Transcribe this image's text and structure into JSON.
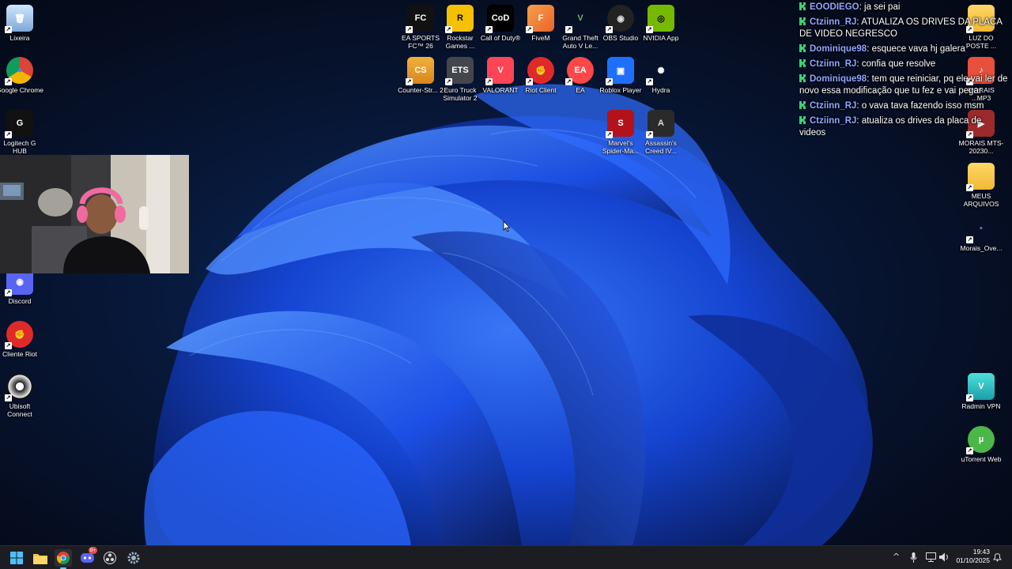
{
  "desktop_left": [
    {
      "name": "recycle-bin",
      "label": "Lixeira",
      "icon": "trash-icon"
    },
    {
      "name": "google-chrome",
      "label": "Google Chrome",
      "icon": "chrome-icon"
    },
    {
      "name": "logitech-g-hub",
      "label": "Logitech G HUB",
      "icon": "logitech-icon"
    },
    {
      "name": "discord",
      "label": "Discord",
      "icon": "discord-icon"
    },
    {
      "name": "cliente-riot",
      "label": "Cliente Riot",
      "icon": "riot-icon"
    },
    {
      "name": "ubisoft-connect",
      "label": "Ubisoft Connect",
      "icon": "ubisoft-icon"
    }
  ],
  "desktop_top": [
    {
      "name": "ea-sports-fc",
      "label": "EA SPORTS FC™ 26",
      "icon": "easports-icon",
      "glyph": "FC"
    },
    {
      "name": "rockstar-games",
      "label": "Rockstar Games ...",
      "icon": "rockstar-icon",
      "glyph": "R"
    },
    {
      "name": "call-of-duty",
      "label": "Call of Duty®",
      "icon": "cod-icon",
      "glyph": "CoD"
    },
    {
      "name": "fivem",
      "label": "FiveM",
      "icon": "fivem-icon",
      "glyph": "F"
    },
    {
      "name": "gta-v",
      "label": "Grand Theft Auto V Le...",
      "icon": "gta-icon",
      "glyph": "V"
    },
    {
      "name": "obs-studio",
      "label": "OBS Studio",
      "icon": "obs-icon",
      "glyph": "◉"
    },
    {
      "name": "nvidia-app",
      "label": "NVIDIA App",
      "icon": "nvidia-icon",
      "glyph": "◎"
    },
    {
      "name": "counter-strike-2",
      "label": "Counter-Str... 2",
      "icon": "cs2-icon",
      "glyph": "CS"
    },
    {
      "name": "euro-truck-simulator-2",
      "label": "Euro Truck Simulator 2",
      "icon": "truck-icon",
      "glyph": "ETS"
    },
    {
      "name": "valorant",
      "label": "VALORANT",
      "icon": "valorant-icon",
      "glyph": "V"
    },
    {
      "name": "riot-client",
      "label": "Riot Client",
      "icon": "riot-icon",
      "glyph": "✊"
    },
    {
      "name": "ea",
      "label": "EA",
      "icon": "ea-icon",
      "glyph": "EA"
    },
    {
      "name": "roblox-player",
      "label": "Roblox Player",
      "icon": "roblox-icon",
      "glyph": "▣"
    },
    {
      "name": "hydra",
      "label": "Hydra",
      "icon": "hydra-icon",
      "glyph": "✺"
    },
    {
      "name": "marvels-spider-man",
      "label": "Marvel's Spider-Ma...",
      "icon": "spiderman-icon",
      "glyph": "S"
    },
    {
      "name": "assassins-creed",
      "label": "Assassin's Creed IV...",
      "icon": "assassins-icon",
      "glyph": "A"
    }
  ],
  "desktop_right": [
    {
      "name": "luz-do-poste",
      "label": "LUZ DO POSTE ...",
      "icon": "folder-icon"
    },
    {
      "name": "morais-mp3",
      "label": "MORAIS ...MP3",
      "icon": "audio-file-icon"
    },
    {
      "name": "morais-mts",
      "label": "MORAIS MTS-20230...",
      "icon": "video-file-icon"
    },
    {
      "name": "meus-arquivos",
      "label": "MEUS ARQUIVOS",
      "icon": "folder-icon"
    },
    {
      "name": "morais-ove",
      "label": "Morais_Ove...",
      "icon": "file-icon"
    },
    {
      "name": "radmin-vpn",
      "label": "Radmin VPN",
      "icon": "radmin-icon"
    },
    {
      "name": "utorrent-web",
      "label": "uTorrent Web",
      "icon": "utorrent-icon"
    }
  ],
  "chat": [
    {
      "user": "EOODIEGO",
      "text": "ja sei pai"
    },
    {
      "user": "Ctziinn_RJ",
      "text": "ATUALIZA OS DRIVES DA PLACA DE VIDEO NEGRESCO"
    },
    {
      "user": "Dominique98",
      "text": "esquece vava hj galera"
    },
    {
      "user": "Ctziinn_RJ",
      "text": "confia que resolve"
    },
    {
      "user": "Dominique98",
      "text": "tem que reiniciar, pq ele vai ler de novo essa modificação que tu fez e vai pegar"
    },
    {
      "user": "Ctziinn_RJ",
      "text": "o vava tava fazendo isso msm"
    },
    {
      "user": "Ctziinn_RJ",
      "text": "atualiza os drives da placa de videos"
    }
  ],
  "taskbar": {
    "apps": [
      {
        "name": "start-button",
        "icon": "windows-icon"
      },
      {
        "name": "file-explorer",
        "icon": "folder-icon"
      },
      {
        "name": "chrome",
        "icon": "chrome-icon"
      },
      {
        "name": "discord",
        "icon": "discord-icon",
        "badge": "9+"
      },
      {
        "name": "obs",
        "icon": "obs-icon"
      },
      {
        "name": "settings",
        "icon": "gear-icon"
      }
    ],
    "time": "19:43",
    "date": "01/10/2025"
  },
  "colors": {
    "accent": "#60cdff",
    "chat_user": "#8fa6ff",
    "badge_green": "#3bd16f"
  }
}
